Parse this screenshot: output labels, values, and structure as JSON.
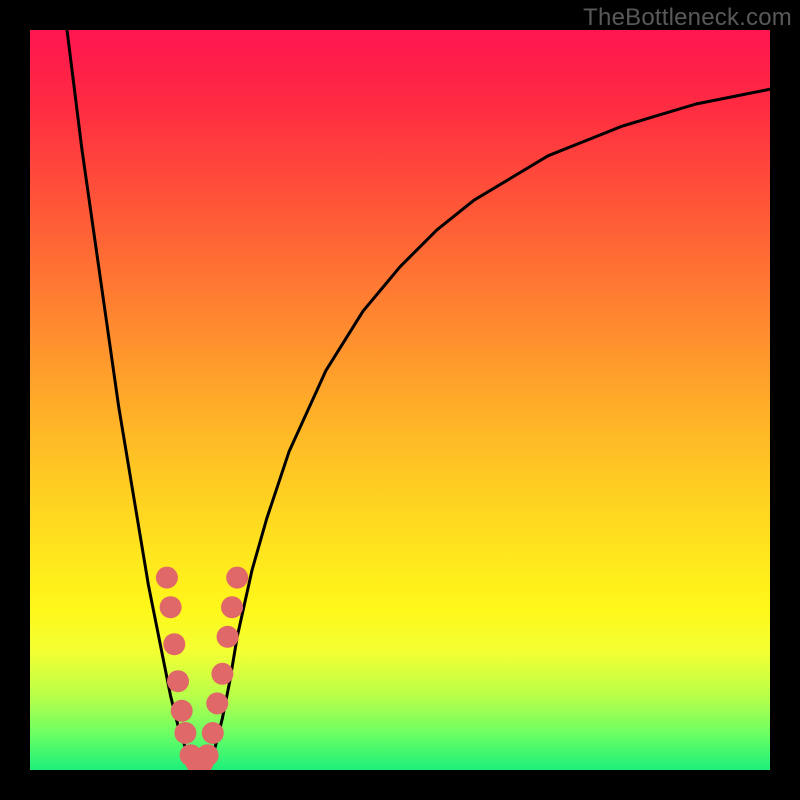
{
  "watermark": "TheBottleneck.com",
  "gradient": {
    "stops": [
      {
        "offset": 0.0,
        "color": "#ff1550"
      },
      {
        "offset": 0.1,
        "color": "#ff2b42"
      },
      {
        "offset": 0.25,
        "color": "#ff5a37"
      },
      {
        "offset": 0.4,
        "color": "#ff8a2f"
      },
      {
        "offset": 0.55,
        "color": "#ffba26"
      },
      {
        "offset": 0.7,
        "color": "#ffe41e"
      },
      {
        "offset": 0.78,
        "color": "#fff71a"
      },
      {
        "offset": 0.84,
        "color": "#f3ff33"
      },
      {
        "offset": 0.9,
        "color": "#b9ff4a"
      },
      {
        "offset": 0.95,
        "color": "#6dff63"
      },
      {
        "offset": 1.0,
        "color": "#1cf07a"
      }
    ]
  },
  "chart_data": {
    "type": "line",
    "title": "",
    "xlabel": "",
    "ylabel": "",
    "xlim": [
      0,
      100
    ],
    "ylim": [
      0,
      100
    ],
    "series": [
      {
        "name": "bottleneck-curve",
        "x": [
          5,
          6,
          7,
          8,
          9,
          10,
          11,
          12,
          13,
          14,
          15,
          16,
          17,
          18,
          19,
          20,
          21,
          22,
          23,
          24,
          25,
          26,
          27,
          28,
          30,
          32,
          35,
          40,
          45,
          50,
          55,
          60,
          65,
          70,
          75,
          80,
          85,
          90,
          95,
          100
        ],
        "y": [
          100,
          92,
          84,
          77,
          70,
          63,
          56,
          49,
          43,
          37,
          31,
          25,
          20,
          15,
          10,
          6,
          3,
          1,
          0,
          1,
          3,
          7,
          12,
          18,
          27,
          34,
          43,
          54,
          62,
          68,
          73,
          77,
          80,
          83,
          85,
          87,
          88.5,
          90,
          91,
          92
        ]
      }
    ],
    "minimum_x": 23,
    "markers": {
      "name": "highlight-cluster",
      "color": "#e06868",
      "points": [
        {
          "x": 18.5,
          "y": 26
        },
        {
          "x": 19.0,
          "y": 22
        },
        {
          "x": 19.5,
          "y": 17
        },
        {
          "x": 20.0,
          "y": 12
        },
        {
          "x": 20.5,
          "y": 8
        },
        {
          "x": 21.0,
          "y": 5
        },
        {
          "x": 21.7,
          "y": 2
        },
        {
          "x": 22.5,
          "y": 1
        },
        {
          "x": 23.3,
          "y": 1
        },
        {
          "x": 24.0,
          "y": 2
        },
        {
          "x": 24.7,
          "y": 5
        },
        {
          "x": 25.3,
          "y": 9
        },
        {
          "x": 26.0,
          "y": 13
        },
        {
          "x": 26.7,
          "y": 18
        },
        {
          "x": 27.3,
          "y": 22
        },
        {
          "x": 28.0,
          "y": 26
        }
      ]
    }
  }
}
